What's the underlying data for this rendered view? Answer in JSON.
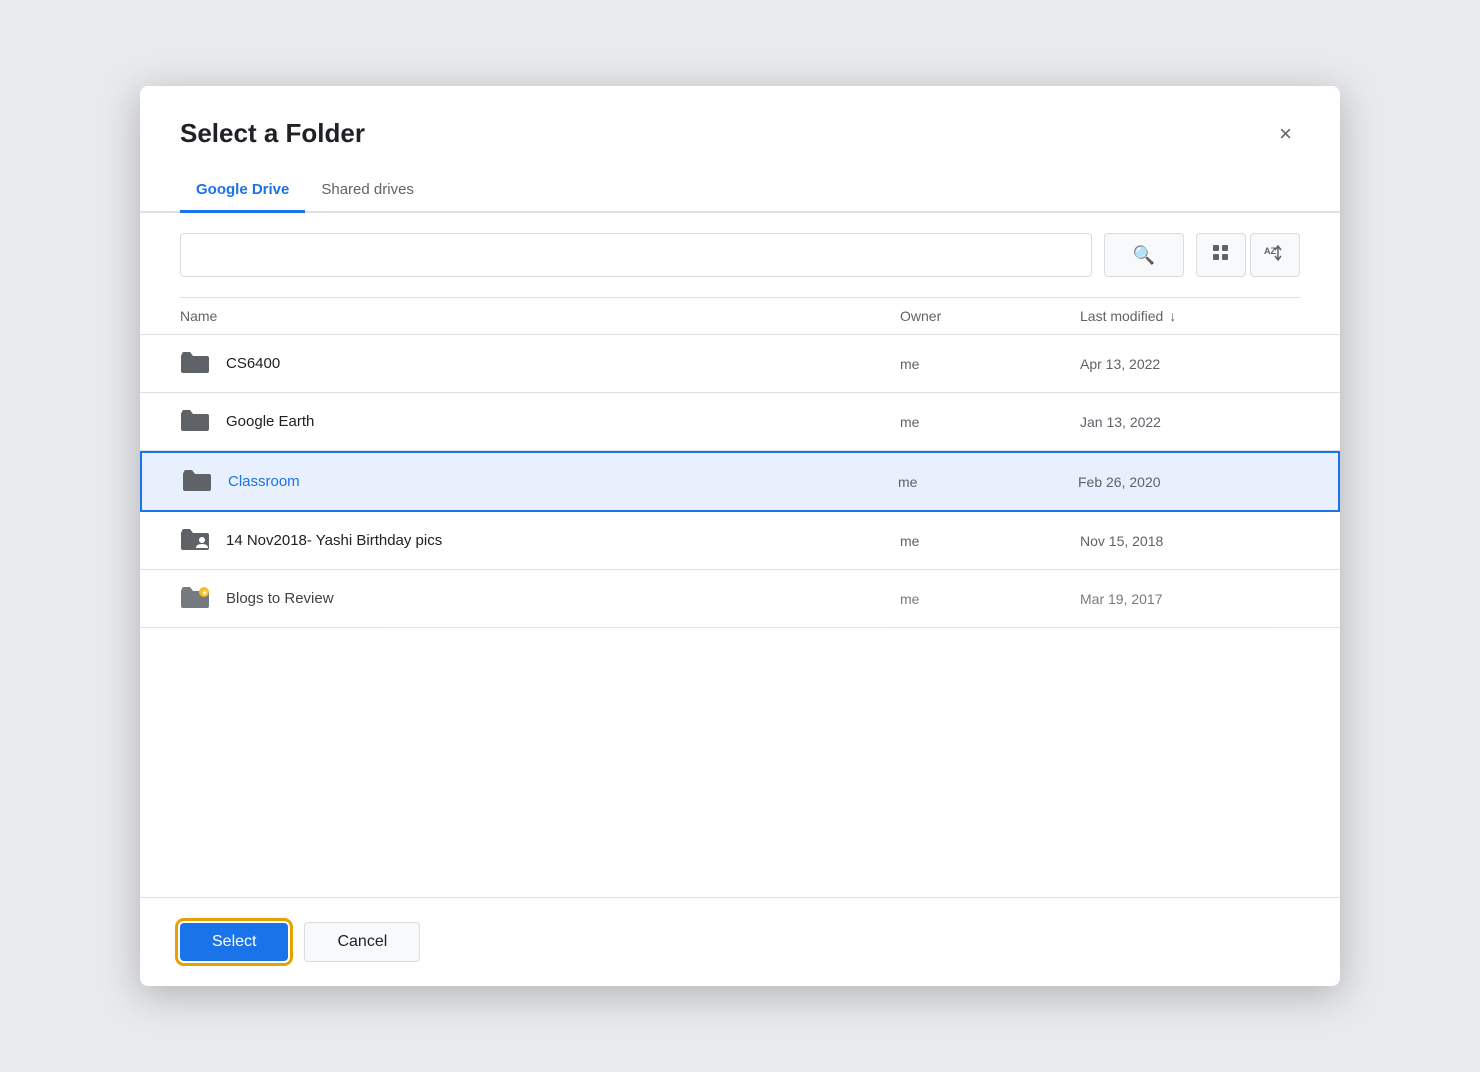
{
  "dialog": {
    "title": "Select a Folder",
    "close_label": "×"
  },
  "tabs": [
    {
      "id": "google-drive",
      "label": "Google Drive",
      "active": true
    },
    {
      "id": "shared-drives",
      "label": "Shared drives",
      "active": false
    }
  ],
  "search": {
    "placeholder": "",
    "search_button_label": "🔍",
    "grid_button_label": "⊞",
    "sort_button_label": "AZ↕"
  },
  "table": {
    "columns": [
      {
        "id": "name",
        "label": "Name"
      },
      {
        "id": "owner",
        "label": "Owner"
      },
      {
        "id": "last_modified",
        "label": "Last modified"
      }
    ],
    "rows": [
      {
        "id": "row-cs6400",
        "name": "CS6400",
        "owner": "me",
        "last_modified": "Apr 13, 2022",
        "type": "folder",
        "selected": false
      },
      {
        "id": "row-google-earth",
        "name": "Google Earth",
        "owner": "me",
        "last_modified": "Jan 13, 2022",
        "type": "folder",
        "selected": false
      },
      {
        "id": "row-classroom",
        "name": "Classroom",
        "owner": "me",
        "last_modified": "Feb 26, 2020",
        "type": "folder",
        "selected": true
      },
      {
        "id": "row-birthday-pics",
        "name": "14 Nov2018- Yashi Birthday pics",
        "owner": "me",
        "last_modified": "Nov 15, 2018",
        "type": "shared-folder",
        "selected": false
      },
      {
        "id": "row-blogs",
        "name": "Blogs to Review",
        "owner": "me",
        "last_modified": "Mar 19, 2017",
        "type": "folder-starred",
        "selected": false,
        "partial": true
      }
    ]
  },
  "footer": {
    "select_label": "Select",
    "cancel_label": "Cancel"
  },
  "colors": {
    "accent": "#1a73e8",
    "selected_bg": "#e8f0fe",
    "selected_border": "#1a73e8",
    "select_btn_outline": "#e8a000"
  }
}
